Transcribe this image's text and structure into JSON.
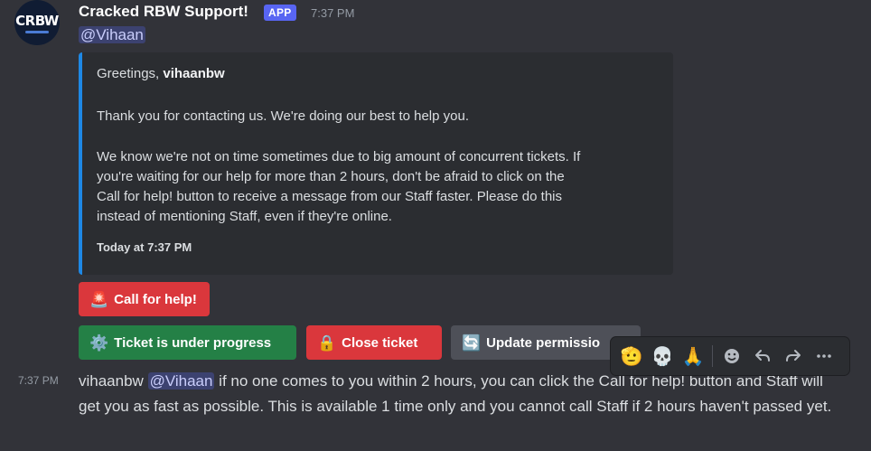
{
  "header": {
    "username": "Cracked RBW Support!",
    "app_tag": "APP",
    "time": "7:37 PM",
    "avatar_text": "CRBW",
    "mention": "@Vihaan"
  },
  "embed": {
    "greeting_prefix": "Greetings, ",
    "greeting_name": "vihaanbw",
    "line1": "Thank you for contacting us. We're doing our best to help you.",
    "para_lines": [
      "We know we're not on time sometimes due to big amount of concurrent tickets. If",
      "you're waiting for our help for more than 2 hours, don't be afraid to click on the",
      "Call for help! button to receive a message from our Staff faster. Please do this",
      "instead of mentioning Staff, even if they're online."
    ],
    "footer": "Today at 7:37 PM",
    "accent": "#1e88e5"
  },
  "buttons": {
    "call": {
      "label": "Call for help!",
      "icon": "siren-icon",
      "color": "#da373c"
    },
    "progress": {
      "label": "Ticket is under progress",
      "icon": "gear-icon",
      "color": "#248046"
    },
    "close": {
      "label": "Close ticket",
      "icon": "lock-icon",
      "color": "#da373c"
    },
    "update": {
      "label": "Update permissio",
      "icon": "refresh-icon",
      "color": "#4e5058"
    }
  },
  "message": {
    "time": "7:37 PM",
    "author": "vihaanbw",
    "mention": "@Vihaan",
    "text_after": " if no one comes to you within 2 hours, you can click the Call for help! button and Staff will get you as fast as possible. This is available 1 time only and you cannot call Staff if 2 hours haven't passed yet."
  },
  "toolbar": {
    "reactions": [
      "🫡",
      "💀",
      "🙏"
    ],
    "actions": [
      "add-reaction-icon",
      "reply-icon",
      "forward-icon",
      "more-icon"
    ]
  }
}
